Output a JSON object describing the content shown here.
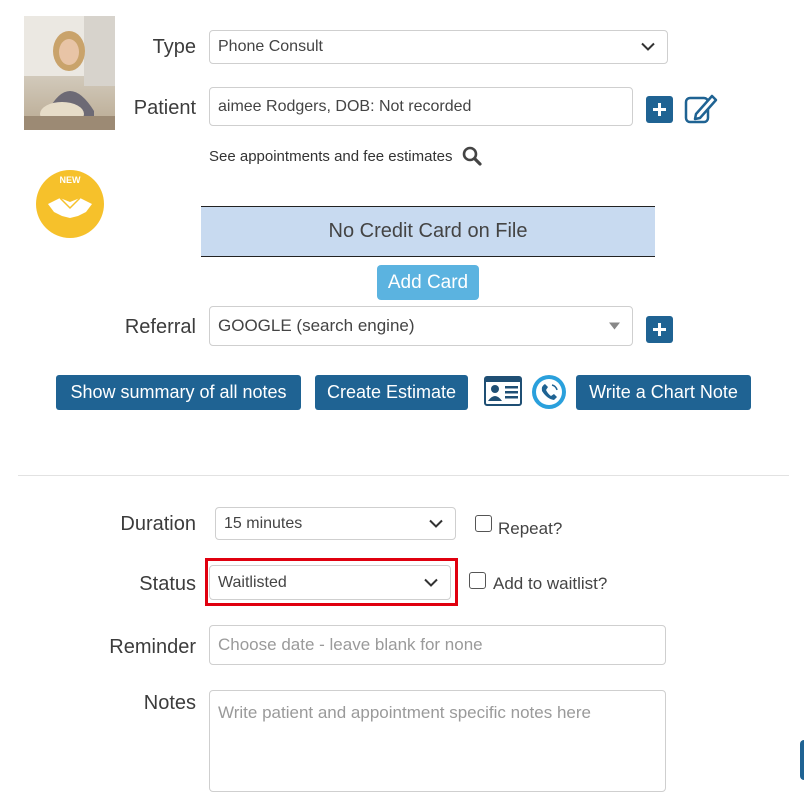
{
  "form": {
    "type_label": "Type",
    "type_value": "Phone Consult",
    "patient_label": "Patient",
    "patient_value": "aimee Rodgers, DOB: Not recorded",
    "see_appointments_text": "See appointments and fee estimates",
    "new_badge_text": "NEW",
    "credit_card_text": "No Credit Card on File",
    "add_card_label": "Add Card",
    "referral_label": "Referral",
    "referral_value": "GOOGLE (search engine)"
  },
  "actions": {
    "show_summary_label": "Show summary of all notes",
    "create_estimate_label": "Create Estimate",
    "write_chart_note_label": "Write a Chart Note"
  },
  "details": {
    "duration_label": "Duration",
    "duration_value": "15 minutes",
    "repeat_label": "Repeat?",
    "status_label": "Status",
    "status_value": "Waitlisted",
    "waitlist_label": "Add to waitlist?",
    "reminder_label": "Reminder",
    "reminder_placeholder": "Choose date - leave blank for none",
    "notes_label": "Notes",
    "notes_placeholder": "Write patient and appointment specific notes here"
  },
  "colors": {
    "primary_button": "#1f6393",
    "add_card_button": "#5bb3e0",
    "credit_card_box": "#c8daf0",
    "highlight_border": "#e0000f",
    "new_badge": "#f6c12b"
  }
}
